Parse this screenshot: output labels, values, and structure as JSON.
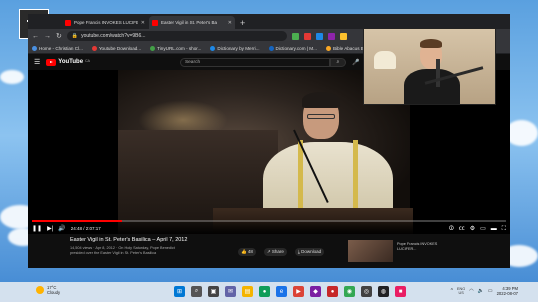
{
  "browser": {
    "tabs": [
      {
        "title": "Pope Francis INVOKES LUCIFER",
        "active": false
      },
      {
        "title": "Easter Vigil in St. Peter's Ba",
        "active": true
      }
    ],
    "address": "youtube.com/watch?v=9B6...",
    "bookmarks": [
      {
        "label": "Home - Christian Cl...",
        "color": "#4a90e2"
      },
      {
        "label": "Youtube Download...",
        "color": "#e53935"
      },
      {
        "label": "TinyURL.com - shor...",
        "color": "#43a047"
      },
      {
        "label": "Dictionary by Merri...",
        "color": "#1e88e5"
      },
      {
        "label": "Dictionary.com | M...",
        "color": "#1565c0"
      },
      {
        "label": "Bible Abacus Bi...",
        "color": "#f9a825"
      }
    ]
  },
  "youtube": {
    "logo": "YouTube",
    "logo_region": "CA",
    "search_placeholder": "Search",
    "time": "24:48 / 2:07:17",
    "progress": 0.19,
    "video_title": "Easter Vigil in St. Peter's Basilica – April 7, 2012",
    "video_meta": "14,504 views · Apr 8, 2012 · On Holy Saturday, Pope Benedict presided over the Easter Vigil in St. Peter's Basilica",
    "actions": [
      "48",
      "Share",
      "Download"
    ],
    "suggestion": "Pope Francis INVOKES LUCIFER..."
  },
  "taskbar": {
    "weather_temp": "17°C",
    "weather_desc": "Cloudy",
    "lang": "ENG",
    "region": "US",
    "time": "4:39 PM",
    "date": "2022-08-07"
  },
  "colors": {
    "accent": "#ff0000",
    "player_bg": "#000000",
    "yt_bg": "#0f0f0f"
  }
}
